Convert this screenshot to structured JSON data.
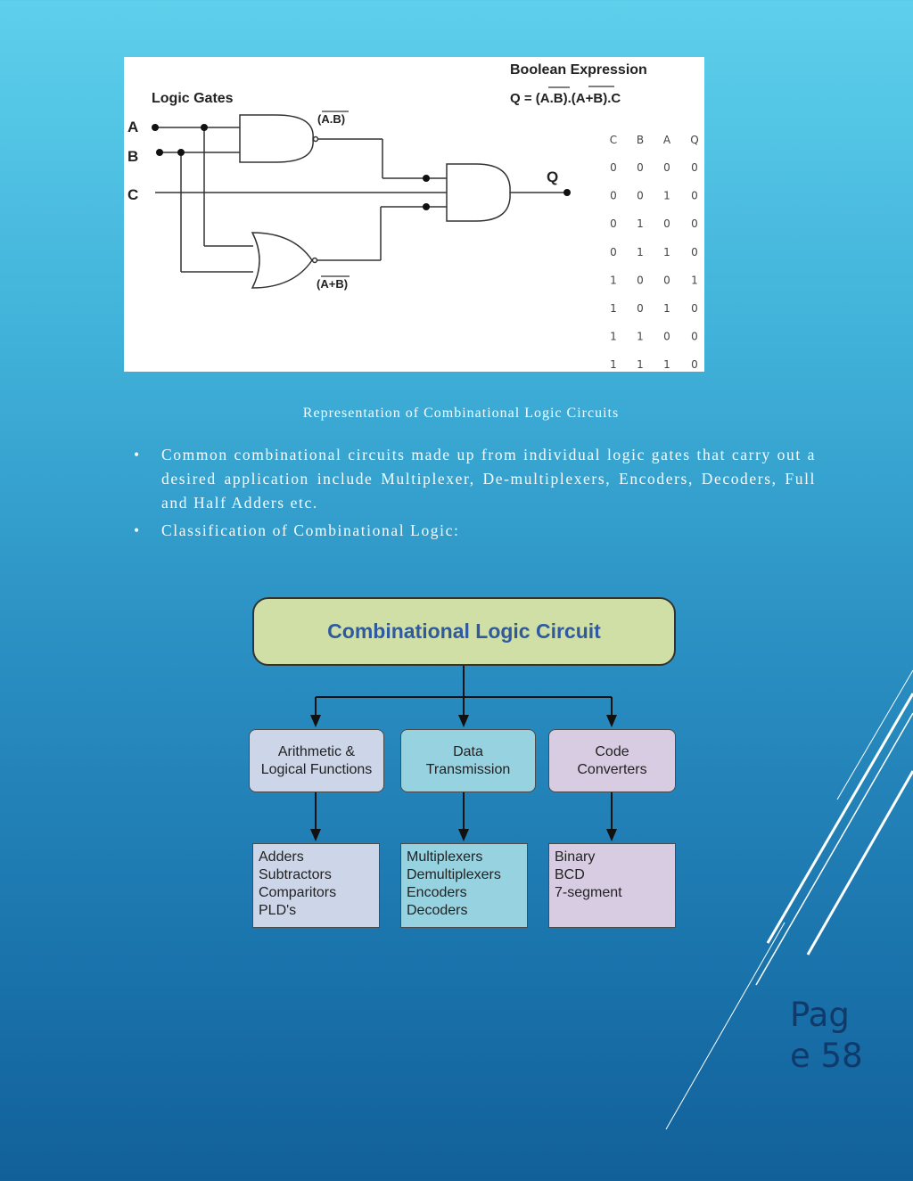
{
  "figure": {
    "title_left": "Logic Gates",
    "title_right": "Boolean Expression",
    "expression_prefix": "Q = (",
    "expr_ab": "A.B",
    "expr_mid": ").(",
    "expr_apb": "A+B",
    "expr_suffix": ").C",
    "inputs": [
      "A",
      "B",
      "C"
    ],
    "output": "Q",
    "nand_label_open": "(",
    "nand_label": "A.B",
    "nand_label_close": ")",
    "nor_label_open": "(",
    "nor_label": "A+B",
    "nor_label_close": ")",
    "truth_table": {
      "headers": [
        "C",
        "B",
        "A",
        "Q"
      ],
      "rows": [
        [
          "0",
          "0",
          "0",
          "0"
        ],
        [
          "0",
          "0",
          "1",
          "0"
        ],
        [
          "0",
          "1",
          "0",
          "0"
        ],
        [
          "0",
          "1",
          "1",
          "0"
        ],
        [
          "1",
          "0",
          "0",
          "1"
        ],
        [
          "1",
          "0",
          "1",
          "0"
        ],
        [
          "1",
          "1",
          "0",
          "0"
        ],
        [
          "1",
          "1",
          "1",
          "0"
        ]
      ]
    }
  },
  "caption": "Representation of Combinational Logic Circuits",
  "bullets": [
    "Common combinational circuits made up from individual logic gates that carry out a desired application include Multiplexer, De-multiplexers, Encoders, Decoders, Full and Half Adders etc.",
    "Classification of Combinational Logic:"
  ],
  "bullet_glyph": "•",
  "tree": {
    "root": "Combinational Logic Circuit",
    "categories": [
      {
        "line1": "Arithmetic &",
        "line2": "Logical Functions",
        "color": "#cdd6e8",
        "items": [
          "Adders",
          "Subtractors",
          "Comparitors",
          "PLD's"
        ]
      },
      {
        "line1": "Data",
        "line2": "Transmission",
        "color": "#97d2e0",
        "items": [
          "Multiplexers",
          "Demultiplexers",
          "Encoders",
          "Decoders"
        ]
      },
      {
        "line1": "Code",
        "line2": "Converters",
        "color": "#d8cce2",
        "items": [
          "Binary",
          "BCD",
          "7-segment"
        ]
      }
    ]
  },
  "page": {
    "line1": "Pag",
    "line2": "e 58"
  }
}
